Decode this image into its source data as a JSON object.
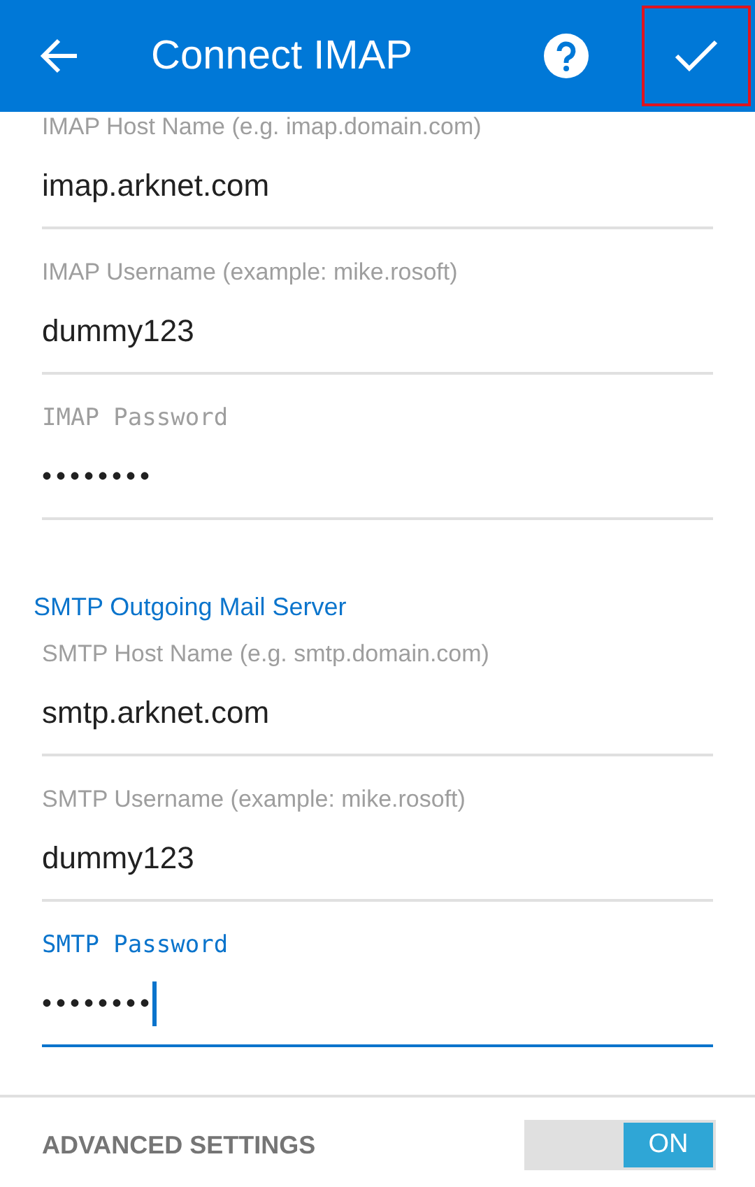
{
  "app_bar": {
    "title": "Connect IMAP",
    "confirm_highlighted": true
  },
  "sections": [
    {
      "fields": [
        {
          "kind": "text",
          "label": "IMAP Host Name (e.g. imap.domain.com)",
          "value": "imap.arknet.com",
          "focused": false
        },
        {
          "kind": "text",
          "label": "IMAP Username (example: mike.rosoft)",
          "value": "dummy123",
          "focused": false
        },
        {
          "kind": "password",
          "label": "IMAP Password",
          "value": "••••••••",
          "focused": false
        }
      ]
    },
    {
      "header": "SMTP Outgoing Mail Server",
      "fields": [
        {
          "kind": "text",
          "label": "SMTP Host Name (e.g. smtp.domain.com)",
          "value": "smtp.arknet.com",
          "focused": false
        },
        {
          "kind": "text",
          "label": "SMTP Username (example: mike.rosoft)",
          "value": "dummy123",
          "focused": false
        },
        {
          "kind": "password",
          "label": "SMTP Password",
          "value": "••••••••",
          "focused": true
        }
      ]
    }
  ],
  "advanced": {
    "label": "ADVANCED SETTINGS",
    "toggle_text": "ON",
    "on": true
  }
}
